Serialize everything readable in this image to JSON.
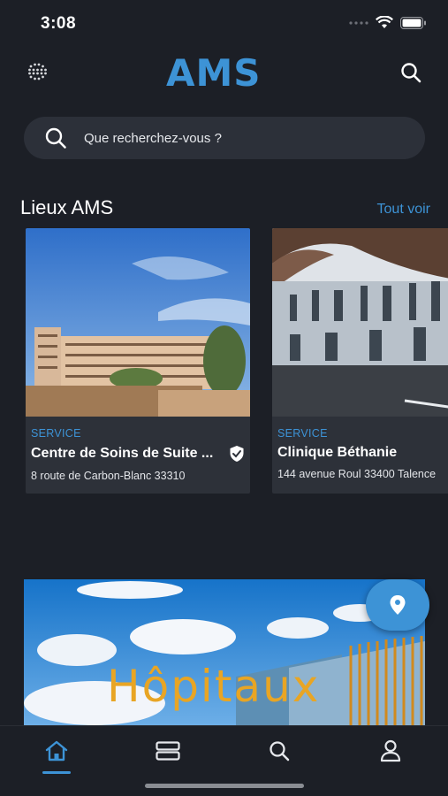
{
  "status_bar": {
    "time": "3:08"
  },
  "header": {
    "logo_text": "AMS"
  },
  "search": {
    "placeholder": "Que recherchez-vous ?"
  },
  "section": {
    "title": "Lieux AMS",
    "see_all": "Tout voir"
  },
  "cards": [
    {
      "type": "SERVICE",
      "title": "Centre de Soins de Suite ...",
      "address": "8 route de Carbon-Blanc 33310",
      "verified": true
    },
    {
      "type": "SERVICE",
      "title": "Clinique Béthanie",
      "address": "144 avenue Roul 33400 Talence"
    }
  ],
  "banner": {
    "text": "Hôpitaux"
  },
  "tabs": [
    {
      "name": "home",
      "active": true
    },
    {
      "name": "list"
    },
    {
      "name": "search"
    },
    {
      "name": "profile"
    }
  ],
  "colors": {
    "accent": "#3d93d6",
    "background": "#1c1f26",
    "card": "#2d3139",
    "banner_text": "#e8a524"
  }
}
